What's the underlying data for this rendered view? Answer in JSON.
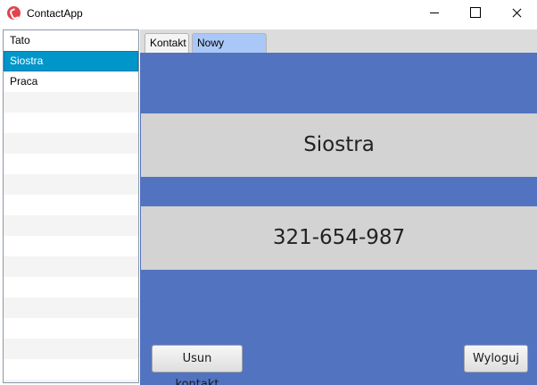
{
  "window": {
    "title": "ContactApp",
    "icon": "phone-icon"
  },
  "contacts": {
    "items": [
      "Tato",
      "Siostra",
      "Praca"
    ],
    "selected": "Siostra"
  },
  "tabs": [
    {
      "label": "Kontakt",
      "active": false
    },
    {
      "label": "Nowy kontakt",
      "active": true
    }
  ],
  "detail": {
    "name": "Siostra",
    "phone": "321-654-987"
  },
  "actions": {
    "delete_label": "Usun kontakt",
    "logout_label": "Wyloguj"
  },
  "colors": {
    "panel": "#5273c0",
    "selected_item": "#0096c9",
    "active_tab": "#a9c8f7"
  }
}
